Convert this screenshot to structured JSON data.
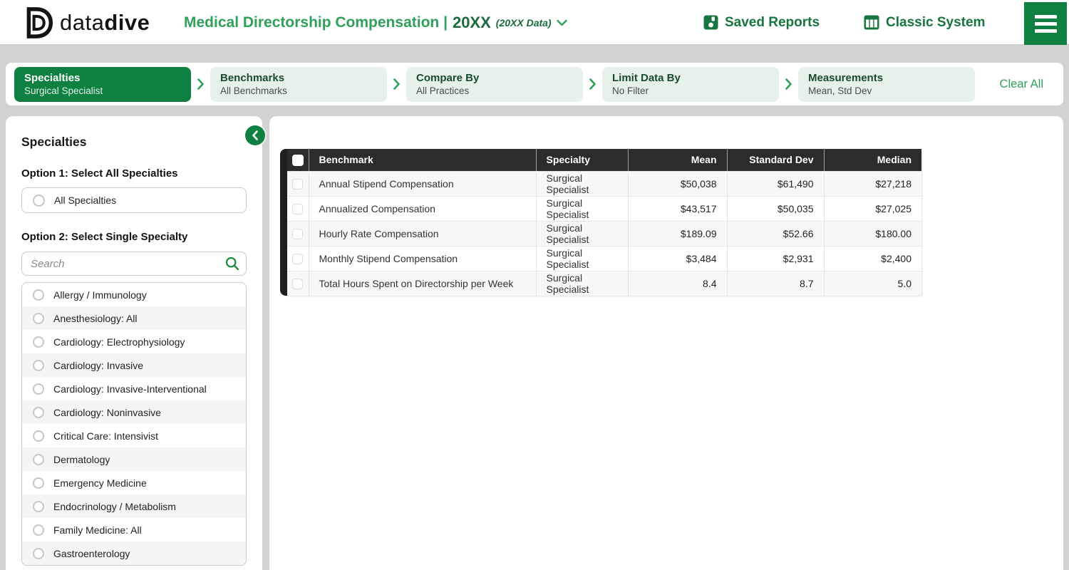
{
  "header": {
    "logo_letter": "D",
    "brand_regular": "data",
    "brand_bold": "dive",
    "title_main": "Medical Directorship Compensation |",
    "title_year": "20XX",
    "title_dataset": "(20XX Data)",
    "saved_reports_label": "Saved Reports",
    "classic_system_label": "Classic System"
  },
  "steps": [
    {
      "label": "Specialties",
      "value": "Surgical Specialist",
      "active": true
    },
    {
      "label": "Benchmarks",
      "value": "All Benchmarks",
      "active": false
    },
    {
      "label": "Compare By",
      "value": "All Practices",
      "active": false
    },
    {
      "label": "Limit Data By",
      "value": "No Filter",
      "active": false
    },
    {
      "label": "Measurements",
      "value": "Mean, Std Dev",
      "active": false
    }
  ],
  "clear_all_label": "Clear All",
  "sidebar": {
    "title": "Specialties",
    "option1_heading": "Option 1: Select All Specialties",
    "all_specialties_label": "All Specialties",
    "option2_heading": "Option 2: Select Single Specialty",
    "search_placeholder": "Search",
    "specialties": [
      "Allergy / Immunology",
      "Anesthesiology: All",
      "Cardiology: Electrophysiology",
      "Cardiology: Invasive",
      "Cardiology: Invasive-Interventional",
      "Cardiology: Noninvasive",
      "Critical Care: Intensivist",
      "Dermatology",
      "Emergency Medicine",
      "Endocrinology / Metabolism",
      "Family Medicine: All",
      "Gastroenterology"
    ]
  },
  "table": {
    "columns": [
      "Benchmark",
      "Specialty",
      "Mean",
      "Standard Dev",
      "Median"
    ],
    "rows": [
      {
        "benchmark": "Annual Stipend Compensation",
        "specialty": "Surgical Specialist",
        "mean": "$50,038",
        "std": "$61,490",
        "median": "$27,218"
      },
      {
        "benchmark": "Annualized Compensation",
        "specialty": "Surgical Specialist",
        "mean": "$43,517",
        "std": "$50,035",
        "median": "$27,025"
      },
      {
        "benchmark": "Hourly Rate Compensation",
        "specialty": "Surgical Specialist",
        "mean": "$189.09",
        "std": "$52.66",
        "median": "$180.00"
      },
      {
        "benchmark": "Monthly Stipend Compensation",
        "specialty": "Surgical Specialist",
        "mean": "$3,484",
        "std": "$2,931",
        "median": "$2,400"
      },
      {
        "benchmark": "Total Hours Spent on Directorship per Week",
        "specialty": "Surgical Specialist",
        "mean": "8.4",
        "std": "8.7",
        "median": "5.0"
      }
    ]
  },
  "icons": {
    "logo": "datadive-d-logo",
    "save": "save-icon",
    "columns": "columns-icon",
    "menu": "hamburger-icon",
    "dropdown": "chevron-down-icon",
    "step_separator": "chevron-right-icon",
    "collapse": "chevron-left-icon",
    "search": "search-icon"
  },
  "colors": {
    "brand_green": "#0E8142",
    "title_green": "#2FA05A",
    "dark_green_text": "#17753F",
    "step_inactive_bg": "#E7F1EB",
    "table_header_bg": "#2A2C2D",
    "accent_bar": "#1D1F20",
    "page_bg": "#D2D2D2",
    "stripe": "#F5F5F5"
  }
}
